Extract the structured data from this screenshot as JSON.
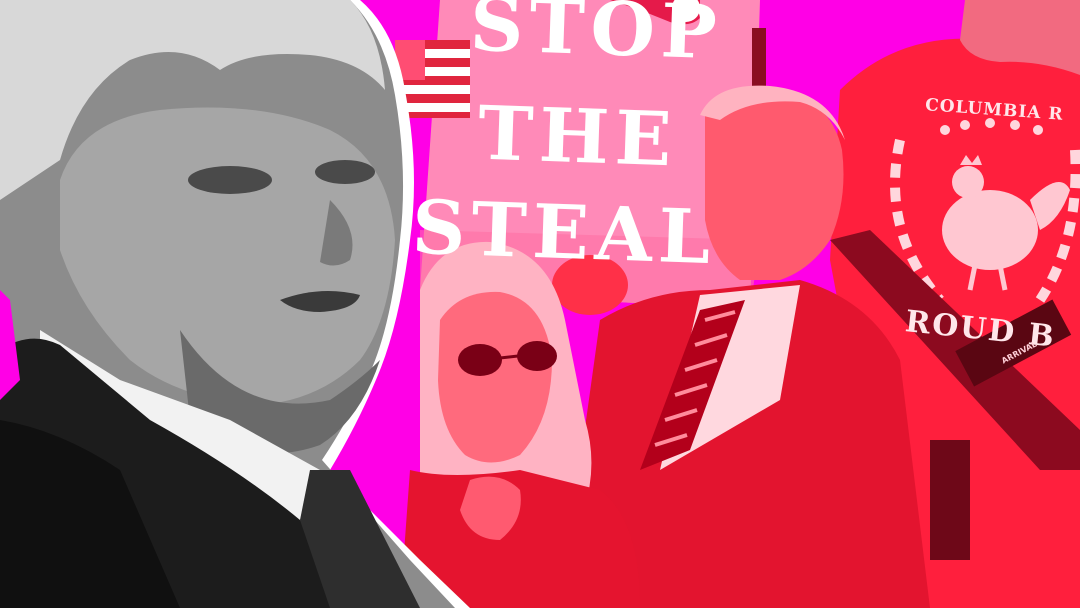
{
  "colors": {
    "background": "#ff00e6",
    "red_layer": "#ff1a3a",
    "pink_sign": "#ff8ab0",
    "grayscale_dark": "#1a1a1a",
    "white_outline": "#ffffff"
  },
  "sign": {
    "line1": "STOP",
    "line2": "THE",
    "line3": "STEAL"
  },
  "jacket": {
    "top_text": "COLUMBIA R",
    "bottom_text": "ROUD B"
  },
  "gun": {
    "label": "ARRIVAL"
  }
}
